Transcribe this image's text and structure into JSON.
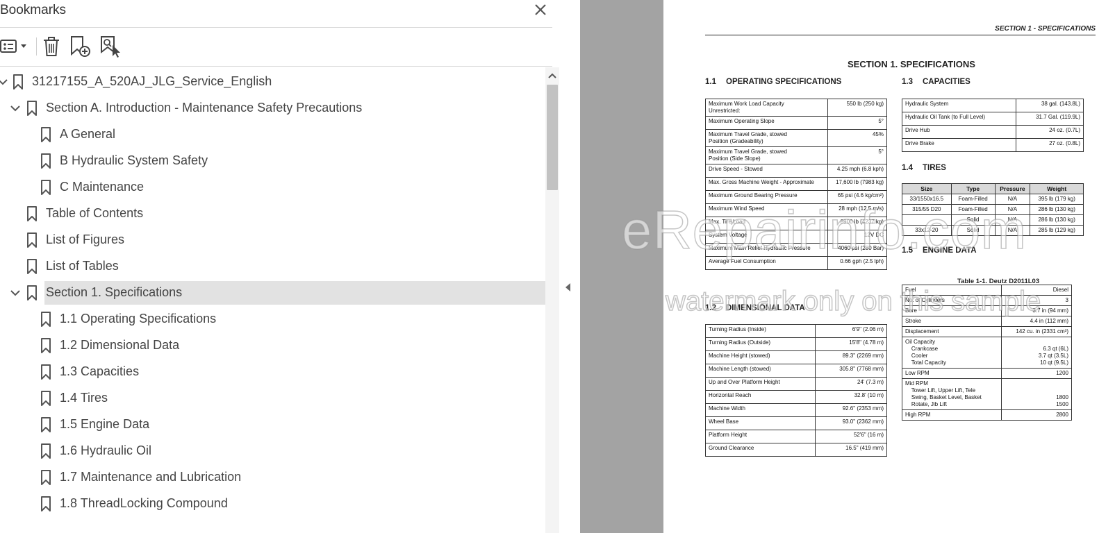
{
  "panel": {
    "title": "Bookmarks",
    "toolbar": {
      "options_icon": "list-options-icon",
      "delete_icon": "trash-icon",
      "new_icon": "bookmark-add-icon",
      "find_icon": "bookmark-find-icon"
    },
    "bookmarks": [
      {
        "label": "31217155_A_520AJ_JLG_Service_English",
        "level": 0,
        "expanded": true
      },
      {
        "label": "Section A. Introduction - Maintenance Safety Precautions",
        "level": 1,
        "expanded": true
      },
      {
        "label": "A General",
        "level": 2
      },
      {
        "label": "B Hydraulic System Safety",
        "level": 2
      },
      {
        "label": "C Maintenance",
        "level": 2
      },
      {
        "label": "Table of Contents",
        "level": 1
      },
      {
        "label": "List of Figures",
        "level": 1
      },
      {
        "label": "List of Tables",
        "level": 1
      },
      {
        "label": "Section 1. Specifications",
        "level": 1,
        "expanded": true,
        "selected": true
      },
      {
        "label": "1.1 Operating Specifications",
        "level": 2
      },
      {
        "label": "1.2 Dimensional Data",
        "level": 2
      },
      {
        "label": "1.3 Capacities",
        "level": 2
      },
      {
        "label": "1.4 Tires",
        "level": 2
      },
      {
        "label": "1.5 Engine Data",
        "level": 2
      },
      {
        "label": "1.6 Hydraulic Oil",
        "level": 2
      },
      {
        "label": "1.7 Maintenance and Lubrication",
        "level": 2
      },
      {
        "label": "1.8 ThreadLocking Compound",
        "level": 2
      }
    ]
  },
  "doc": {
    "running_head": "SECTION 1 - SPECIFICATIONS",
    "section_title": "SECTION 1.  SPECIFICATIONS",
    "h_operating": {
      "num": "1.1",
      "title": "OPERATING SPECIFICATIONS"
    },
    "h_dimensional": {
      "num": "1.2",
      "title": "DIMENSIONAL DATA"
    },
    "h_capacities": {
      "num": "1.3",
      "title": "CAPACITIES"
    },
    "h_tires": {
      "num": "1.4",
      "title": "TIRES"
    },
    "h_engine": {
      "num": "1.5",
      "title": "ENGINE DATA"
    },
    "engine_caption": "Table 1-1. Deutz D2011L03",
    "operating": [
      {
        "label": "Maximum Work Load Capacity\nUnrestricted:",
        "value": "550 lb (250 kg)"
      },
      {
        "label": "Maximum Operating Slope",
        "value": "5°"
      },
      {
        "label": "Maximum Travel Grade, stowed\nPosition (Gradeability)",
        "value": "45%"
      },
      {
        "label": "Maximum Travel Grade, stowed\nPosition (Side Slope)",
        "value": "5°"
      },
      {
        "label": "Drive Speed - Stowed",
        "value": "4.25 mph (6.8 kph)"
      },
      {
        "label": "Max. Gross Machine Weight - Approximate",
        "value": "17,600 lb (7983 kg)"
      },
      {
        "label": "Maximum Ground Bearing Pressure",
        "value": "65 psi (4.6 kg/cm²)"
      },
      {
        "label": "Maximum Wind Speed",
        "value": "28 mph (12.5 m/s)"
      },
      {
        "label": "Max. Tire Load",
        "value": "8900 lb (4237 kg)"
      },
      {
        "label": "System Voltage",
        "value": "12V DC"
      },
      {
        "label": "Maximum Main Relief Hydraulic Pressure",
        "value": "4060 psi (280 Bar)"
      },
      {
        "label": "Average Fuel Consumption",
        "value": "0.66 gph (2.5 lph)"
      }
    ],
    "dimensional": [
      {
        "label": "Turning Radius (Inside)",
        "value": "6'9\" (2.06 m)"
      },
      {
        "label": "Turning Radius (Outside)",
        "value": "15'8\" (4.78 m)"
      },
      {
        "label": "Machine Height (stowed)",
        "value": "89.3\" (2269 mm)"
      },
      {
        "label": "Machine Length (stowed)",
        "value": "305.8\" (7768 mm)"
      },
      {
        "label": "Up and Over Platform Height",
        "value": "24' (7.3 m)"
      },
      {
        "label": "Horizontal Reach",
        "value": "32.8' (10 m)"
      },
      {
        "label": "Machine Width",
        "value": "92.6\" (2353 mm)"
      },
      {
        "label": "Wheel Base",
        "value": "93.0\" (2362 mm)"
      },
      {
        "label": "Platform Height",
        "value": "52'6\" (16 m)"
      },
      {
        "label": "Ground Clearance",
        "value": "16.5\" (419 mm)"
      }
    ],
    "capacities": [
      {
        "label": "Hydraulic System",
        "value": "38 gal. (143.8L)"
      },
      {
        "label": "Hydraulic Oil Tank (to Full Level)",
        "value": "31.7 Gal. (119.9L)"
      },
      {
        "label": "Drive Hub",
        "value": "24 oz. (0.7L)"
      },
      {
        "label": "Drive Brake",
        "value": "27 oz. (0.8L)"
      }
    ],
    "tires_headers": [
      "Size",
      "Type",
      "Pressure",
      "Weight"
    ],
    "tires": [
      [
        "33/1550x16.5",
        "Foam-Filled",
        "N/A",
        "395 lb (179 kg)"
      ],
      [
        "315/55 D20",
        "Foam-Filled",
        "N/A",
        "286 lb (130 kg)"
      ],
      [
        "",
        "Solid",
        "N/A",
        "286 lb (130 kg)"
      ],
      [
        "33x12-20",
        "Solid",
        "N/A",
        "285 lb (129 kg)"
      ]
    ],
    "engine": [
      {
        "label": "Fuel",
        "value": "Diesel"
      },
      {
        "label": "No. of Cylinders",
        "value": "3"
      },
      {
        "label": "Bore",
        "value": "3.7 in (94 mm)"
      },
      {
        "label": "Stroke",
        "value": "4.4 in (112 mm)"
      },
      {
        "label": "Displacement",
        "value": "142 cu. in (2331 cm³)"
      },
      {
        "label": "Oil Capacity\n    Crankcase\n    Cooler\n    Total Capacity",
        "value": "\n6.3 qt (6L)\n3.7 qt (3.5L)\n10 qt (9.5L)"
      },
      {
        "label": "Low RPM",
        "value": "1200"
      },
      {
        "label": "Mid RPM\n    Tower Lift, Upper Lift, Tele\n    Swing, Basket Level, Basket\n    Rotate, Jib Lift",
        "value": "\n\n1800\n1500"
      },
      {
        "label": "High RPM",
        "value": "2800"
      }
    ],
    "watermark_1": "eRepairinfo.com",
    "watermark_2": "watermark only on this sample"
  },
  "colors": {
    "selected_row": "#e2e2e2",
    "gutter": "#a3a3a3",
    "panel_bg": "#ffffff"
  }
}
